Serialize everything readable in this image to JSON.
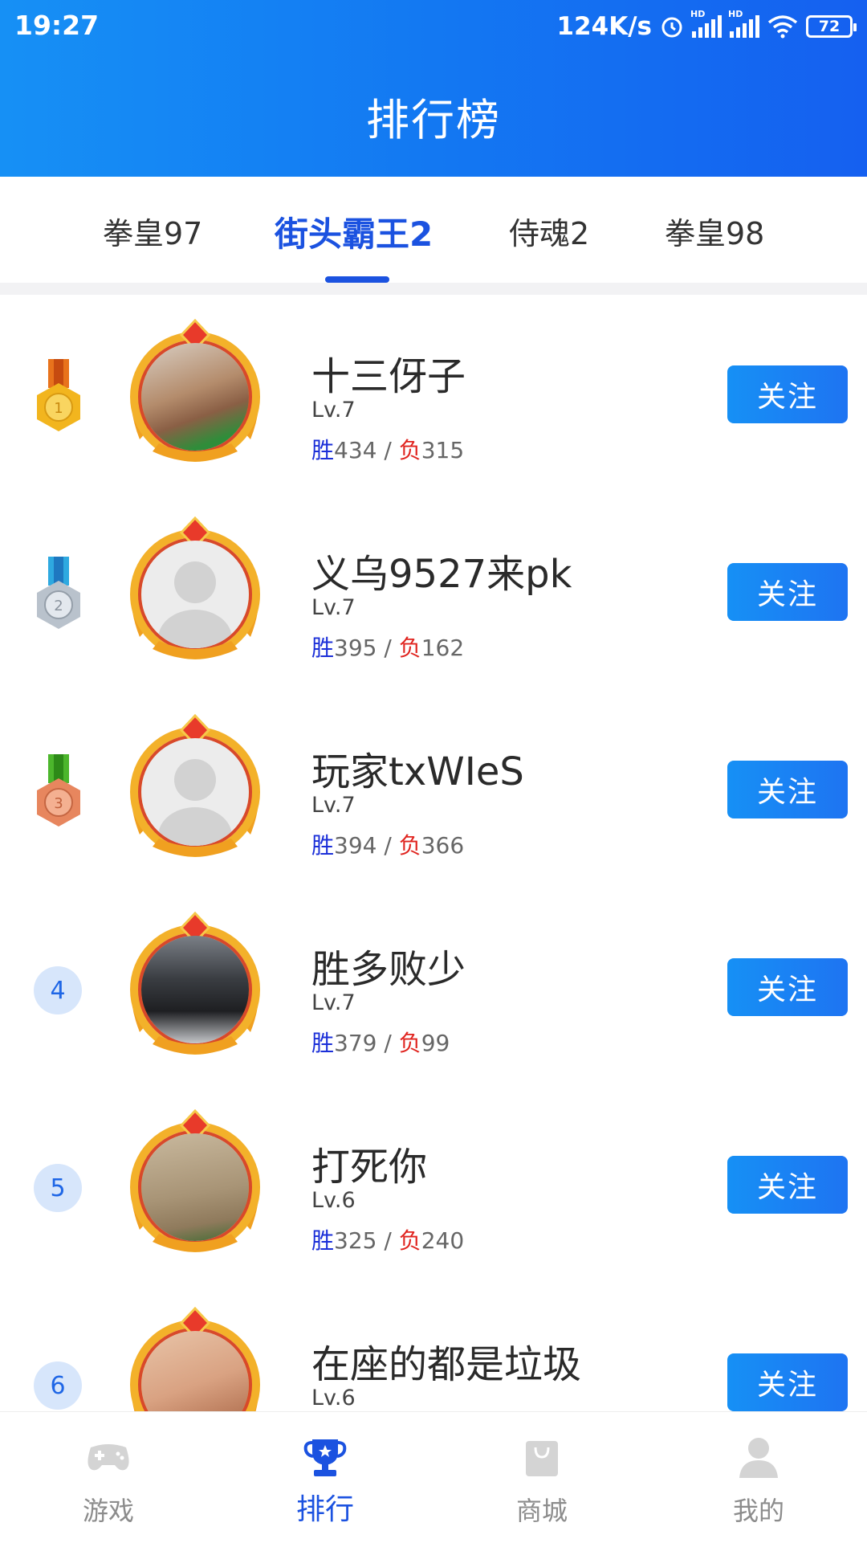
{
  "status_bar": {
    "time": "19:27",
    "net_speed": "124K/s",
    "battery": "72",
    "hd_label": "HD"
  },
  "header": {
    "title": "排行榜"
  },
  "tabs": [
    {
      "label": "拳皇97",
      "active": false
    },
    {
      "label": "街头霸王2",
      "active": true
    },
    {
      "label": "侍魂2",
      "active": false
    },
    {
      "label": "拳皇98",
      "active": false
    }
  ],
  "ranking": {
    "follow_label": "关注",
    "win_prefix": "胜",
    "lose_prefix": "负",
    "separator": " / ",
    "entries": [
      {
        "rank": "1",
        "medal": "gold-medal",
        "name": "十三伢子",
        "level": "Lv.7",
        "wins": "434",
        "losses": "315"
      },
      {
        "rank": "2",
        "medal": "silver-medal",
        "name": "义乌9527来pk",
        "level": "Lv.7",
        "wins": "395",
        "losses": "162"
      },
      {
        "rank": "3",
        "medal": "bronze-medal",
        "name": "玩家txWIeS",
        "level": "Lv.7",
        "wins": "394",
        "losses": "366"
      },
      {
        "rank": "4",
        "medal": "",
        "name": "胜多败少",
        "level": "Lv.7",
        "wins": "379",
        "losses": "99"
      },
      {
        "rank": "5",
        "medal": "",
        "name": "打死你",
        "level": "Lv.6",
        "wins": "325",
        "losses": "240"
      },
      {
        "rank": "6",
        "medal": "",
        "name": "在座的都是垃圾",
        "level": "Lv.6",
        "wins": "",
        "losses": ""
      }
    ]
  },
  "bottom_nav": [
    {
      "label": "游戏",
      "icon": "gamepad-icon",
      "active": false
    },
    {
      "label": "排行",
      "icon": "trophy-icon",
      "active": true
    },
    {
      "label": "商城",
      "icon": "shop-bag-icon",
      "active": false
    },
    {
      "label": "我的",
      "icon": "user-icon",
      "active": false
    }
  ],
  "colors": {
    "primary": "#1b52e0",
    "header_gradient_start": "#1690f5",
    "header_gradient_end": "#1560f0",
    "win": "#1b2fd8",
    "lose": "#e0231e"
  }
}
